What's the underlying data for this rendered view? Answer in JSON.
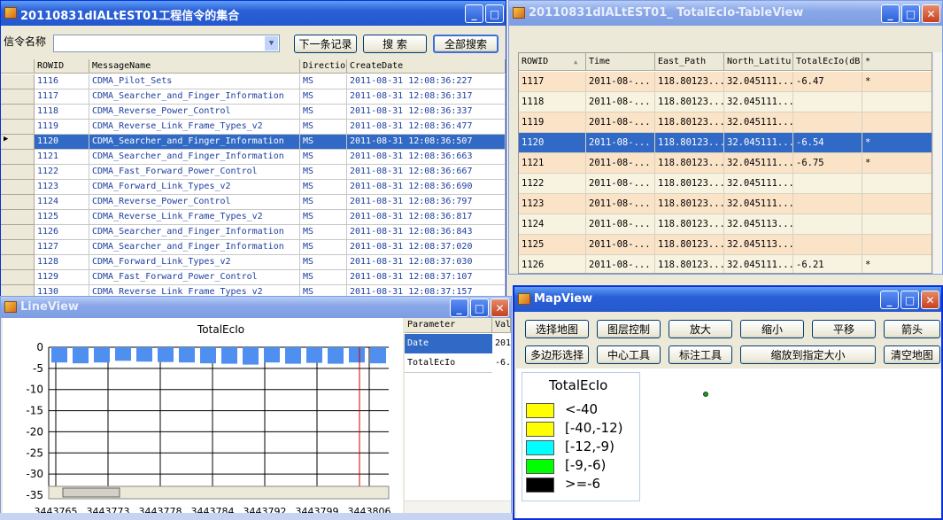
{
  "win1": {
    "title": "20110831dIALtEST01工程信令的集合",
    "filter_label": "信令名称",
    "next_btn": "下一条记录",
    "search_btn": "搜 索",
    "search_all_btn": "全部搜索",
    "columns": [
      "ROWID",
      "MessageName",
      "Directio",
      "CreateDate"
    ],
    "rows": [
      [
        "1116",
        "CDMA_Pilot_Sets",
        "MS",
        "2011-08-31 12:08:36:227"
      ],
      [
        "1117",
        "CDMA_Searcher_and_Finger_Information",
        "MS",
        "2011-08-31 12:08:36:317"
      ],
      [
        "1118",
        "CDMA_Reverse_Power_Control",
        "MS",
        "2011-08-31 12:08:36:337"
      ],
      [
        "1119",
        "CDMA_Reverse_Link_Frame_Types_v2",
        "MS",
        "2011-08-31 12:08:36:477"
      ],
      [
        "1120",
        "CDMA_Searcher_and_Finger_Information",
        "MS",
        "2011-08-31 12:08:36:507"
      ],
      [
        "1121",
        "CDMA_Searcher_and_Finger_Information",
        "MS",
        "2011-08-31 12:08:36:663"
      ],
      [
        "1122",
        "CDMA_Fast_Forward_Power_Control",
        "MS",
        "2011-08-31 12:08:36:667"
      ],
      [
        "1123",
        "CDMA_Forward_Link_Types_v2",
        "MS",
        "2011-08-31 12:08:36:690"
      ],
      [
        "1124",
        "CDMA_Reverse_Power_Control",
        "MS",
        "2011-08-31 12:08:36:797"
      ],
      [
        "1125",
        "CDMA_Reverse_Link_Frame_Types_v2",
        "MS",
        "2011-08-31 12:08:36:817"
      ],
      [
        "1126",
        "CDMA_Searcher_and_Finger_Information",
        "MS",
        "2011-08-31 12:08:36:843"
      ],
      [
        "1127",
        "CDMA_Searcher_and_Finger_Information",
        "MS",
        "2011-08-31 12:08:37:020"
      ],
      [
        "1128",
        "CDMA_Forward_Link_Types_v2",
        "MS",
        "2011-08-31 12:08:37:030"
      ],
      [
        "1129",
        "CDMA_Fast_Forward_Power_Control",
        "MS",
        "2011-08-31 12:08:37:107"
      ],
      [
        "1130",
        "CDMA_Reverse_Link_Frame_Types_v2",
        "MS",
        "2011-08-31 12:08:37:157"
      ]
    ],
    "selected_index": 4
  },
  "win2": {
    "title": "20110831dIALtEST01_ TotalEcIo-TableView",
    "columns": [
      "ROWID",
      "Time",
      "East_Path",
      "North_Latitu",
      "TotalEcIo(dB",
      "*"
    ],
    "rows": [
      [
        "1117",
        "2011-08-...",
        "118.80123...",
        "32.045111...",
        "-6.47",
        "*"
      ],
      [
        "1118",
        "2011-08-...",
        "118.80123...",
        "32.045111...",
        "",
        ""
      ],
      [
        "1119",
        "2011-08-...",
        "118.80123...",
        "32.045111...",
        "",
        ""
      ],
      [
        "1120",
        "2011-08-...",
        "118.80123...",
        "32.045111...",
        "-6.54",
        "*"
      ],
      [
        "1121",
        "2011-08-...",
        "118.80123...",
        "32.045111...",
        "-6.75",
        "*"
      ],
      [
        "1122",
        "2011-08-...",
        "118.80123...",
        "32.045111...",
        "",
        ""
      ],
      [
        "1123",
        "2011-08-...",
        "118.80123...",
        "32.045111...",
        "",
        ""
      ],
      [
        "1124",
        "2011-08-...",
        "118.80123...",
        "32.045113...",
        "",
        ""
      ],
      [
        "1125",
        "2011-08-...",
        "118.80123...",
        "32.045113...",
        "",
        ""
      ],
      [
        "1126",
        "2011-08-...",
        "118.80123...",
        "32.045111...",
        "-6.21",
        "*"
      ]
    ],
    "selected_index": 3
  },
  "win3": {
    "title": "LineView",
    "param_header": "Parameter",
    "value_header": "Val",
    "params": [
      {
        "name": "Date",
        "value": "201"
      },
      {
        "name": "TotalEcIo",
        "value": "-6."
      }
    ]
  },
  "chart_data": {
    "type": "bar",
    "title": "TotalEcIo",
    "ylim": [
      -35,
      0
    ],
    "yticks": [
      0,
      -5,
      -10,
      -15,
      -20,
      -25,
      -30,
      -35
    ],
    "xticks": [
      "3443765",
      "3443773",
      "3443778",
      "3443784",
      "3443792",
      "3443799",
      "3443806"
    ],
    "values": [
      -3.6,
      -3.8,
      -3.6,
      -3.2,
      -3.4,
      -3.5,
      -3.6,
      -3.8,
      -3.9,
      -4.1,
      -3.6,
      -3.9,
      -3.7,
      -3.9,
      -3.6,
      -3.8
    ],
    "colors": {
      "bar": "#4f8fef",
      "marker": "#cc0000"
    }
  },
  "win4": {
    "title": "MapView",
    "buttons": [
      "选择地图",
      "图层控制",
      "放大",
      "缩小",
      "平移",
      "箭头",
      "多边形选择",
      "中心工具",
      "标注工具",
      "缩放到指定大小",
      "清空地图"
    ],
    "legend_title": "TotalEcIo",
    "legend": [
      {
        "label": "<-40",
        "color": "#ffff00"
      },
      {
        "label": "[-40,-12)",
        "color": "#ffff00"
      },
      {
        "label": "[-12,-9)",
        "color": "#00ffff"
      },
      {
        "label": "[-9,-6)",
        "color": "#00ff00"
      },
      {
        "label": ">=-6",
        "color": "#000000"
      }
    ]
  }
}
